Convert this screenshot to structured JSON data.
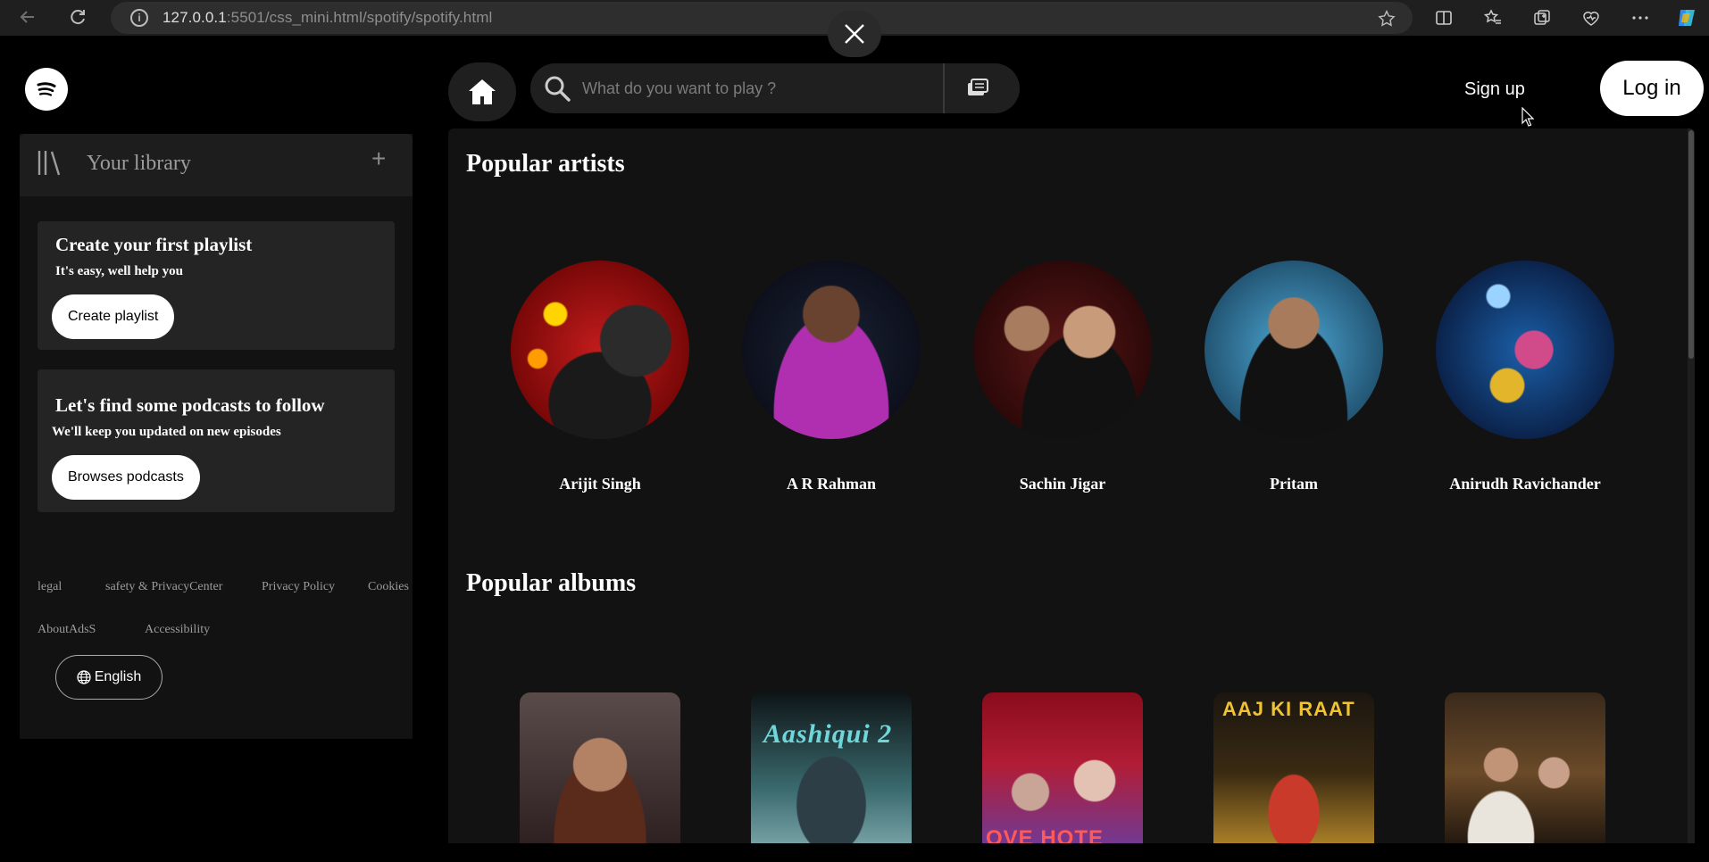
{
  "browser": {
    "url_host": "127.0.0.1",
    "url_rest": ":5501/css_mini.html/spotify/spotify.html"
  },
  "header": {
    "search_placeholder": "What do you want to play ?",
    "signup_label": "Sign up",
    "login_label": "Log in"
  },
  "sidebar": {
    "library_title": "Your library",
    "add_symbol": "+",
    "playlist_card": {
      "title": "Create your first playlist",
      "subtitle": "It's easy, well help you",
      "button": "Create playlist"
    },
    "podcast_card": {
      "title": "Let's find some podcasts to follow",
      "subtitle": "We'll keep you updated on new episodes",
      "button": "Browses podcasts"
    },
    "footer_links": [
      "legal",
      "safety & PrivacyCenter",
      "Privacy Policy",
      "Cookies",
      "AboutAdsS",
      "Accessibility"
    ],
    "language_label": "English"
  },
  "main": {
    "artists_title": "Popular artists",
    "artists": [
      {
        "name": "Arijit Singh"
      },
      {
        "name": "A R Rahman"
      },
      {
        "name": "Sachin Jigar"
      },
      {
        "name": "Pritam"
      },
      {
        "name": "Anirudh Ravichander"
      }
    ],
    "albums_title": "Popular albums",
    "album_cover_texts": [
      "",
      "Aashiqui 2",
      "OVE HOTE",
      "AAJ KI RAAT",
      ""
    ]
  },
  "colors": {
    "background": "#000000",
    "panel": "#121212",
    "card": "#242424",
    "text_primary": "#ffffff",
    "text_muted": "#9b9b9b"
  }
}
